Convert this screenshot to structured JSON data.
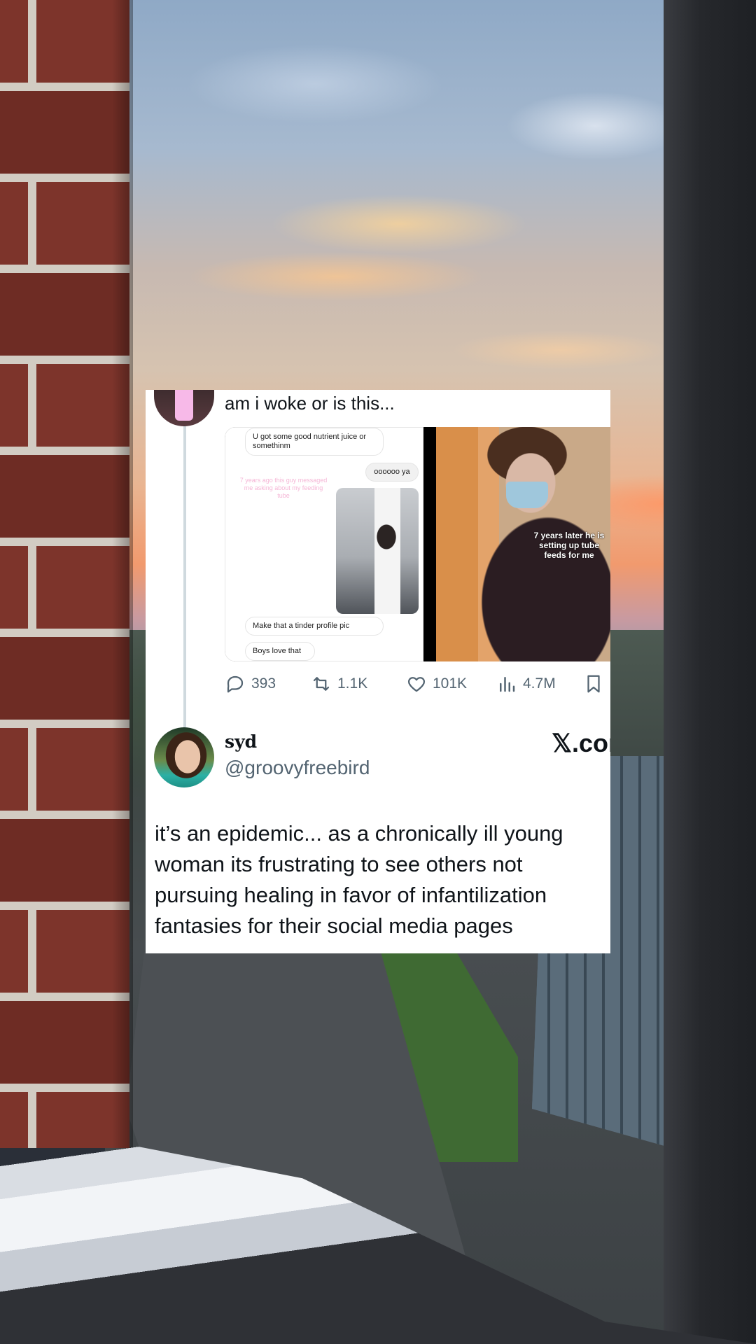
{
  "quoted_tweet": {
    "text": "am i woke or is this...",
    "media": {
      "chat_bubbles": [
        "U got some good nutrient juice or somethinm",
        "oooooo ya",
        "Make that a tinder profile pic",
        "Boys love that"
      ],
      "overlay_note": "7 years ago this guy messaged me asking about my feeding tube",
      "photo_caption": "7 years later he is setting up tube feeds for me"
    },
    "stats": {
      "replies": "393",
      "retweets": "1.1K",
      "likes": "101K",
      "views": "4.7M"
    }
  },
  "tweet": {
    "name": "syd",
    "handle": "@groovyfreebird",
    "brand": "𝕏.com",
    "text": "it’s an epidemic... as a chronically ill young woman its frustrating to see others not pursuing healing in favor of infantilization fantasies for their social media pages"
  },
  "icons": [
    "reply-icon",
    "retweet-icon",
    "like-icon",
    "views-icon",
    "bookmark-icon"
  ]
}
